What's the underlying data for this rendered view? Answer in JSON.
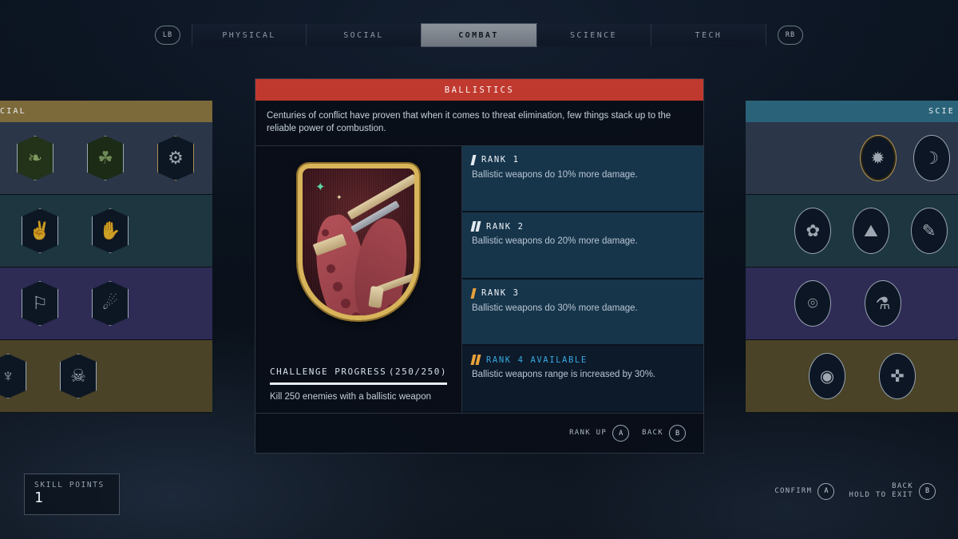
{
  "theme": {
    "bg": "#0a121c",
    "accent_red": "#c0392f",
    "rank_panel": "#16354b",
    "rank_locked": "#0d1a2a",
    "available_blue": "#35a8e0",
    "tick_gold": "#e8a13a",
    "tick_white": "#e3e9ef",
    "left_header": "#7d6a3a",
    "right_header": "#2a6379"
  },
  "tabbar": {
    "left_bumper": "LB",
    "right_bumper": "RB",
    "tabs": [
      {
        "label": "PHYSICAL",
        "active": false
      },
      {
        "label": "SOCIAL",
        "active": false
      },
      {
        "label": "COMBAT",
        "active": true
      },
      {
        "label": "SCIENCE",
        "active": false
      },
      {
        "label": "TECH",
        "active": false
      }
    ]
  },
  "left_panel": {
    "header_label": "CIAL",
    "full_category": "SOCIAL",
    "rows": [
      {
        "tint": "tint-slate",
        "icons": [
          "vine-skill-icon",
          "green-skill-icon",
          "gold-skill-icon"
        ]
      },
      {
        "tint": "tint-teal",
        "icons": [
          "handshake-skill-icon",
          "theft-skill-icon"
        ]
      },
      {
        "tint": "tint-indigo",
        "icons": [
          "leadership-skill-icon",
          "alien-skill-icon"
        ]
      },
      {
        "tint": "tint-olive",
        "icons": [
          "cup-skill-icon",
          "intimidation-skill-icon"
        ]
      }
    ]
  },
  "right_panel": {
    "header_label": "SCIE",
    "full_category": "SCIENCE",
    "rows": [
      {
        "tint": "tint-slate",
        "icons": [
          "astrophysics-skill-icon",
          "planetary-skill-icon"
        ]
      },
      {
        "tint": "tint-teal",
        "icons": [
          "botany-skill-icon",
          "geology-skill-icon",
          "research-skill-icon"
        ]
      },
      {
        "tint": "tint-indigo",
        "icons": [
          "scanning-skill-icon",
          "chemistry-skill-icon"
        ]
      },
      {
        "tint": "tint-olive",
        "icons": [
          "surveying-skill-icon",
          "zoology-skill-icon"
        ]
      }
    ]
  },
  "skill_detail": {
    "title": "BALLISTICS",
    "description": "Centuries of conflict have proven that when it comes to threat elimination, few things stack up to the reliable power of combustion.",
    "badge_name": "ballistics-skill-badge",
    "ranks": [
      {
        "title": "RANK 1",
        "desc": "Ballistic weapons do 10% more damage.",
        "ticks": 1,
        "tick_style": "white",
        "locked": false
      },
      {
        "title": "RANK 2",
        "desc": "Ballistic weapons do 20% more damage.",
        "ticks": 2,
        "tick_style": "white",
        "locked": false
      },
      {
        "title": "RANK 3",
        "desc": "Ballistic weapons do 30% more damage.",
        "ticks": 1,
        "tick_style": "gold",
        "locked": false
      },
      {
        "title": "RANK 4 AVAILABLE",
        "desc": "Ballistic weapons range is increased by 30%.",
        "ticks": 2,
        "tick_style": "gold",
        "locked": true
      }
    ],
    "challenge": {
      "label": "CHALLENGE PROGRESS",
      "counter": "(250/250)",
      "current": 250,
      "total": 250,
      "percent": 100,
      "objective": "Kill 250 enemies with a ballistic weapon"
    },
    "footer_prompts": [
      {
        "label": "RANK UP",
        "button": "A"
      },
      {
        "label": "BACK",
        "button": "B"
      }
    ]
  },
  "skill_points": {
    "label": "SKILL POINTS",
    "value": "1"
  },
  "bottom_prompts": [
    {
      "label": "CONFIRM",
      "sub": "",
      "button": "A"
    },
    {
      "label": "BACK",
      "sub": "HOLD TO EXIT",
      "button": "B"
    }
  ]
}
